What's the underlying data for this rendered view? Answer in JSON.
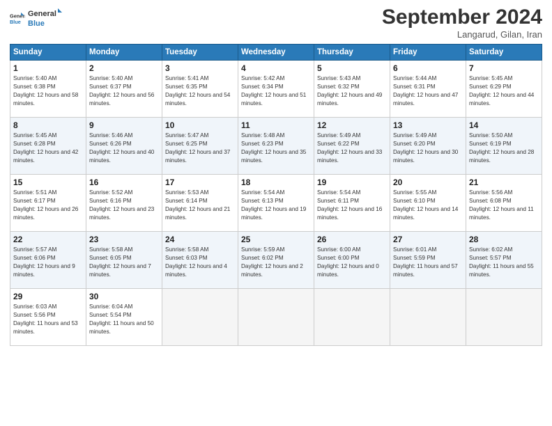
{
  "header": {
    "logo_general": "General",
    "logo_blue": "Blue",
    "month_title": "September 2024",
    "location": "Langarud, Gilan, Iran"
  },
  "weekdays": [
    "Sunday",
    "Monday",
    "Tuesday",
    "Wednesday",
    "Thursday",
    "Friday",
    "Saturday"
  ],
  "weeks": [
    [
      {
        "day": "1",
        "sunrise": "5:40 AM",
        "sunset": "6:38 PM",
        "daylight": "12 hours and 58 minutes."
      },
      {
        "day": "2",
        "sunrise": "5:40 AM",
        "sunset": "6:37 PM",
        "daylight": "12 hours and 56 minutes."
      },
      {
        "day": "3",
        "sunrise": "5:41 AM",
        "sunset": "6:35 PM",
        "daylight": "12 hours and 54 minutes."
      },
      {
        "day": "4",
        "sunrise": "5:42 AM",
        "sunset": "6:34 PM",
        "daylight": "12 hours and 51 minutes."
      },
      {
        "day": "5",
        "sunrise": "5:43 AM",
        "sunset": "6:32 PM",
        "daylight": "12 hours and 49 minutes."
      },
      {
        "day": "6",
        "sunrise": "5:44 AM",
        "sunset": "6:31 PM",
        "daylight": "12 hours and 47 minutes."
      },
      {
        "day": "7",
        "sunrise": "5:45 AM",
        "sunset": "6:29 PM",
        "daylight": "12 hours and 44 minutes."
      }
    ],
    [
      {
        "day": "8",
        "sunrise": "5:45 AM",
        "sunset": "6:28 PM",
        "daylight": "12 hours and 42 minutes."
      },
      {
        "day": "9",
        "sunrise": "5:46 AM",
        "sunset": "6:26 PM",
        "daylight": "12 hours and 40 minutes."
      },
      {
        "day": "10",
        "sunrise": "5:47 AM",
        "sunset": "6:25 PM",
        "daylight": "12 hours and 37 minutes."
      },
      {
        "day": "11",
        "sunrise": "5:48 AM",
        "sunset": "6:23 PM",
        "daylight": "12 hours and 35 minutes."
      },
      {
        "day": "12",
        "sunrise": "5:49 AM",
        "sunset": "6:22 PM",
        "daylight": "12 hours and 33 minutes."
      },
      {
        "day": "13",
        "sunrise": "5:49 AM",
        "sunset": "6:20 PM",
        "daylight": "12 hours and 30 minutes."
      },
      {
        "day": "14",
        "sunrise": "5:50 AM",
        "sunset": "6:19 PM",
        "daylight": "12 hours and 28 minutes."
      }
    ],
    [
      {
        "day": "15",
        "sunrise": "5:51 AM",
        "sunset": "6:17 PM",
        "daylight": "12 hours and 26 minutes."
      },
      {
        "day": "16",
        "sunrise": "5:52 AM",
        "sunset": "6:16 PM",
        "daylight": "12 hours and 23 minutes."
      },
      {
        "day": "17",
        "sunrise": "5:53 AM",
        "sunset": "6:14 PM",
        "daylight": "12 hours and 21 minutes."
      },
      {
        "day": "18",
        "sunrise": "5:54 AM",
        "sunset": "6:13 PM",
        "daylight": "12 hours and 19 minutes."
      },
      {
        "day": "19",
        "sunrise": "5:54 AM",
        "sunset": "6:11 PM",
        "daylight": "12 hours and 16 minutes."
      },
      {
        "day": "20",
        "sunrise": "5:55 AM",
        "sunset": "6:10 PM",
        "daylight": "12 hours and 14 minutes."
      },
      {
        "day": "21",
        "sunrise": "5:56 AM",
        "sunset": "6:08 PM",
        "daylight": "12 hours and 11 minutes."
      }
    ],
    [
      {
        "day": "22",
        "sunrise": "5:57 AM",
        "sunset": "6:06 PM",
        "daylight": "12 hours and 9 minutes."
      },
      {
        "day": "23",
        "sunrise": "5:58 AM",
        "sunset": "6:05 PM",
        "daylight": "12 hours and 7 minutes."
      },
      {
        "day": "24",
        "sunrise": "5:58 AM",
        "sunset": "6:03 PM",
        "daylight": "12 hours and 4 minutes."
      },
      {
        "day": "25",
        "sunrise": "5:59 AM",
        "sunset": "6:02 PM",
        "daylight": "12 hours and 2 minutes."
      },
      {
        "day": "26",
        "sunrise": "6:00 AM",
        "sunset": "6:00 PM",
        "daylight": "12 hours and 0 minutes."
      },
      {
        "day": "27",
        "sunrise": "6:01 AM",
        "sunset": "5:59 PM",
        "daylight": "11 hours and 57 minutes."
      },
      {
        "day": "28",
        "sunrise": "6:02 AM",
        "sunset": "5:57 PM",
        "daylight": "11 hours and 55 minutes."
      }
    ],
    [
      {
        "day": "29",
        "sunrise": "6:03 AM",
        "sunset": "5:56 PM",
        "daylight": "11 hours and 53 minutes."
      },
      {
        "day": "30",
        "sunrise": "6:04 AM",
        "sunset": "5:54 PM",
        "daylight": "11 hours and 50 minutes."
      },
      null,
      null,
      null,
      null,
      null
    ]
  ]
}
